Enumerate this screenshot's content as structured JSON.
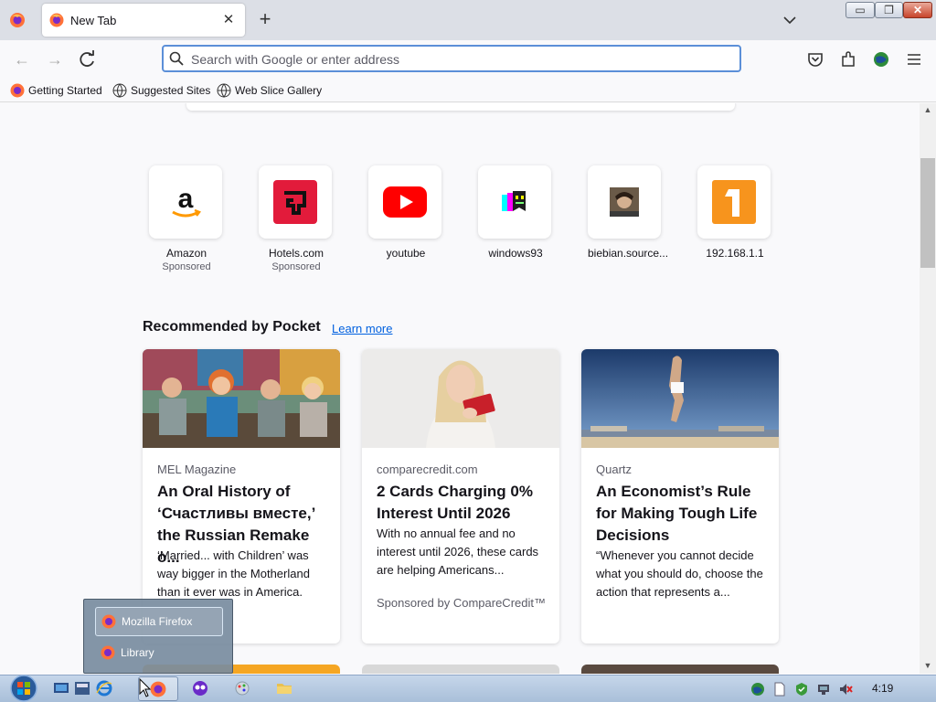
{
  "browser": {
    "tab_title": "New Tab",
    "url_placeholder": "Search with Google or enter address",
    "url_value": ""
  },
  "bookmarks": [
    {
      "label": "Getting Started"
    },
    {
      "label": "Suggested Sites"
    },
    {
      "label": "Web Slice Gallery"
    }
  ],
  "top_sites": [
    {
      "label": "Amazon",
      "sponsor": "Sponsored",
      "icon": "amazon-icon"
    },
    {
      "label": "Hotels.com",
      "sponsor": "Sponsored",
      "icon": "hotels-icon"
    },
    {
      "label": "youtube",
      "sponsor": "",
      "icon": "youtube-icon"
    },
    {
      "label": "windows93",
      "sponsor": "",
      "icon": "windows93-icon"
    },
    {
      "label": "biebian.source...",
      "sponsor": "",
      "icon": "biebian-icon"
    },
    {
      "label": "192.168.1.1",
      "sponsor": "",
      "icon": "router-icon"
    }
  ],
  "pocket": {
    "heading": "Recommended by Pocket",
    "learn_more": "Learn more",
    "cards": [
      {
        "source": "MEL Magazine",
        "title": "An Oral History of ‘Счастливы вместе,’ the Russian Remake o...",
        "excerpt": "‘Married... with Children’ was way bigger in the Motherland than it ever was in America.",
        "sponsor": ""
      },
      {
        "source": "comparecredit.com",
        "title": "2 Cards Charging 0% Interest Until 2026",
        "excerpt": "With no annual fee and no interest until 2026, these cards are helping Americans...",
        "sponsor": "Sponsored by CompareCredit™"
      },
      {
        "source": "Quartz",
        "title": "An Economist’s Rule for Making Tough Life Decisions",
        "excerpt": "“Whenever you cannot decide what you should do, choose the action that represents a...",
        "sponsor": ""
      }
    ]
  },
  "jumplist": {
    "items": [
      {
        "label": "Mozilla Firefox"
      },
      {
        "label": "Library"
      }
    ]
  },
  "taskbar": {
    "clock": "4:19"
  }
}
